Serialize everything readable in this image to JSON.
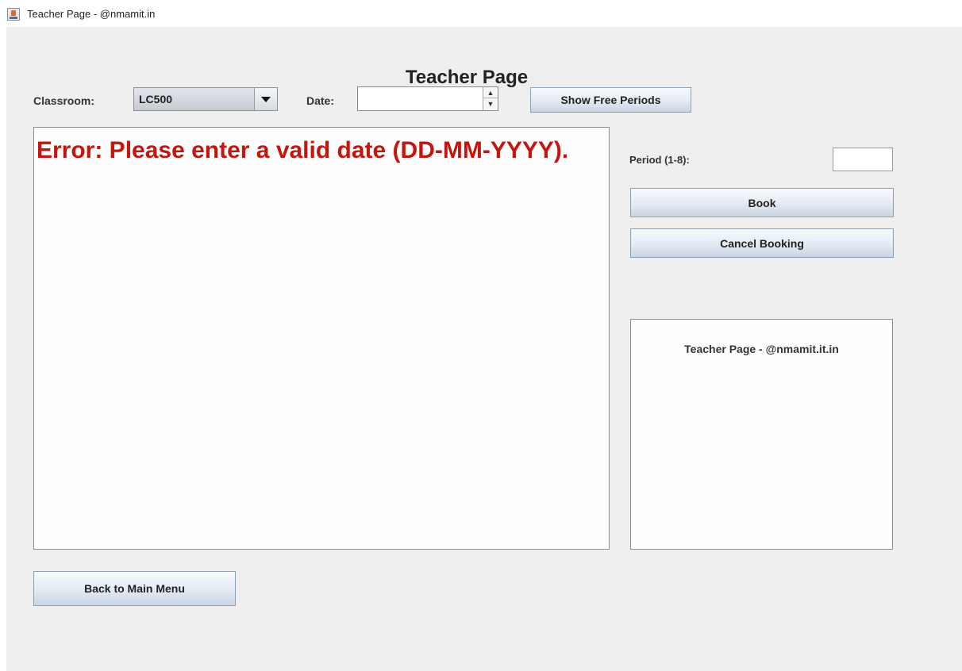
{
  "window": {
    "title": "Teacher Page - @nmamit.in"
  },
  "page": {
    "title": "Teacher Page"
  },
  "toolbar": {
    "classroom_label": "Classroom:",
    "classroom_value": "LC500",
    "date_label": "Date:",
    "date_value": "",
    "show_free_periods_label": "Show Free Periods"
  },
  "output": {
    "message": "Error: Please enter a valid date (DD-MM-YYYY).",
    "message_color": "#c4160e"
  },
  "booking": {
    "period_label": "Period (1-8):",
    "period_value": "",
    "book_label": "Book",
    "cancel_label": "Cancel Booking"
  },
  "side_panel": {
    "text": "Teacher Page - @nmamit.it.in"
  },
  "footer": {
    "back_label": "Back to Main Menu"
  }
}
